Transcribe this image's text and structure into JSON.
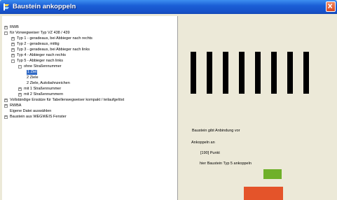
{
  "window": {
    "title": "Baustein ankoppeln",
    "colors": {
      "titlebar": "#1b5fd6",
      "close": "#d8471f",
      "selection": "#316ac5",
      "green": "#6fb02a",
      "red": "#e4542a"
    }
  },
  "tree": {
    "items": [
      {
        "label": "RWB",
        "expander": "+"
      },
      {
        "label": "für Vorwegweiser Typ VZ 438 / 439",
        "expander": "-"
      },
      {
        "label": "Typ 1 - geradeaus, bei Abbieger nach rechts",
        "expander": "+"
      },
      {
        "label": "Typ 2 - geradeaus, mittig",
        "expander": "+"
      },
      {
        "label": "Typ 3 - geradeaus, bei Abbieger nach links",
        "expander": "+"
      },
      {
        "label": "Typ 4 - Abbieger nach rechts",
        "expander": "+"
      },
      {
        "label": "Typ 5 - Abbieger nach links",
        "expander": "-"
      },
      {
        "label": "ohne Straßennummer",
        "expander": "-"
      },
      {
        "label": "1 Ziel",
        "expander": ""
      },
      {
        "label": "2 Ziele",
        "expander": ""
      },
      {
        "label": "2 Ziele, Autobahnzeichen",
        "expander": ""
      },
      {
        "label": "mit 1 Straßennummer",
        "expander": "+"
      },
      {
        "label": "mit 2 Straßennummern",
        "expander": "+"
      },
      {
        "label": "Vollständige Ensätze für Tabellenwegweiser kompakt / teilaufgelöst",
        "expander": "+"
      },
      {
        "label": "RWBA",
        "expander": "+"
      },
      {
        "label": "Eigene Datei auswählen",
        "expander": ""
      },
      {
        "label": "Baustein aus WEGWEIS Fenster",
        "expander": "+"
      }
    ]
  },
  "preview": {
    "lines": [
      "Baustein gibt Anbindung vor",
      "Ankoppeln an",
      "[190] Punkt",
      "hier Baustein Typ 5 ankoppeln"
    ]
  }
}
